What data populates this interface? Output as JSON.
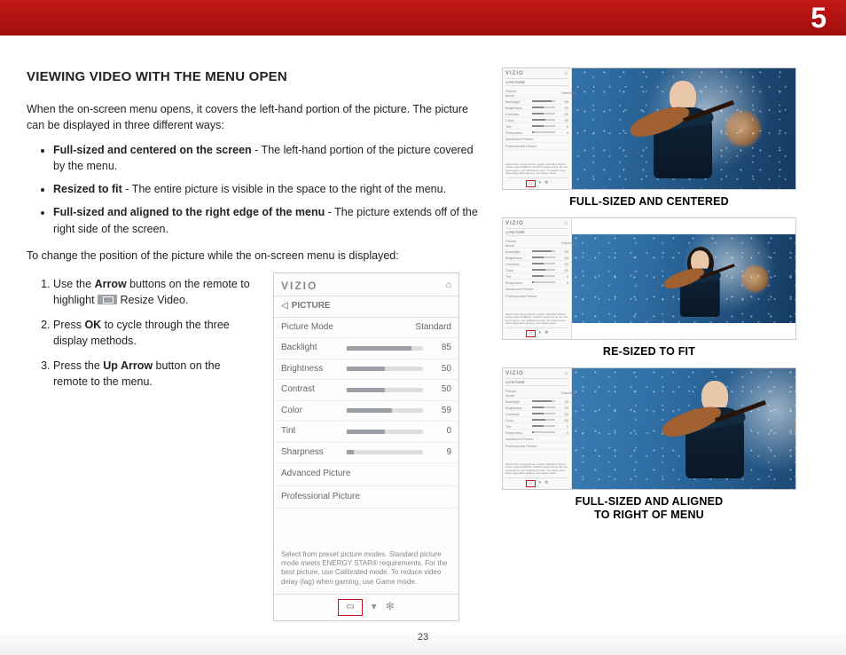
{
  "header": {
    "chapter_number": "5"
  },
  "page_number": "23",
  "section_title": "VIEWING VIDEO WITH THE MENU OPEN",
  "intro": "When the on-screen menu opens, it covers the left-hand portion of the picture. The picture can be displayed in three different ways:",
  "bullets": [
    {
      "bold": "Full-sized and centered on the screen",
      "rest": " - The left-hand portion of the picture covered by the menu."
    },
    {
      "bold": "Resized to fit",
      "rest": " - The entire picture is visible in the space to the right of the menu."
    },
    {
      "bold": "Full-sized and aligned to the right edge of the menu",
      "rest": " - The picture extends off of the right side of the screen."
    }
  ],
  "transition": "To change the position of the picture while the on-screen menu is displayed:",
  "steps": [
    {
      "pre": "Use the ",
      "b1": "Arrow",
      "mid": " buttons on the remote to highlight ",
      "post": " Resize Video."
    },
    {
      "pre": "Press ",
      "b1": "OK",
      "mid": " to cycle through the three display methods.",
      "post": ""
    },
    {
      "pre": "Press the ",
      "b1": "Up Arrow",
      "mid": " button on the remote to the menu.",
      "post": ""
    }
  ],
  "menu": {
    "logo": "VIZIO",
    "home_icon": "⌂",
    "back_icon": "◁",
    "crumb": "PICTURE",
    "rows": [
      {
        "label": "Picture Mode",
        "value": "Standard",
        "pct": null
      },
      {
        "label": "Backlight",
        "value": "85",
        "pct": 85
      },
      {
        "label": "Brightness",
        "value": "50",
        "pct": 50
      },
      {
        "label": "Contrast",
        "value": "50",
        "pct": 50
      },
      {
        "label": "Color",
        "value": "59",
        "pct": 59
      },
      {
        "label": "Tint",
        "value": "0",
        "pct": 50
      },
      {
        "label": "Sharpness",
        "value": "9",
        "pct": 9
      }
    ],
    "links": [
      "Advanced Picture",
      "Professional Picture"
    ],
    "help": "Select from preset picture modes. Standard picture mode meets ENERGY STAR® requirements. For the best picture, use Calibrated mode. To reduce video delay (lag) when gaming, use Game mode.",
    "footer": {
      "resize": "▭",
      "wide": "▾",
      "gear": "✻"
    }
  },
  "captions": {
    "centered": "FULL-SIZED AND CENTERED",
    "fit": "RE-SIZED TO FIT",
    "aligned1": "FULL-SIZED AND ALIGNED",
    "aligned2": "TO RIGHT OF MENU"
  }
}
